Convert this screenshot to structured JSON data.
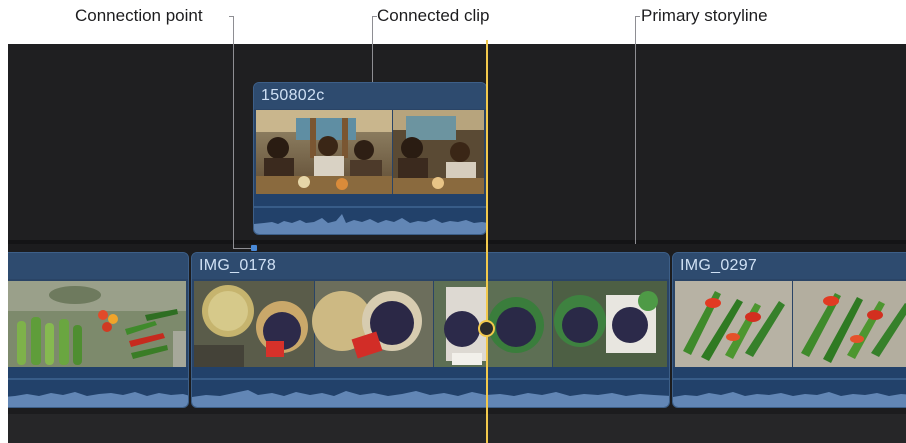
{
  "callouts": {
    "connection_point": "Connection point",
    "connected_clip": "Connected clip",
    "primary_storyline": "Primary storyline"
  },
  "connected_clips": [
    {
      "title": "150802c"
    }
  ],
  "primary_clips": [
    {
      "title": ""
    },
    {
      "title": "IMG_0178"
    },
    {
      "title": "IMG_0297"
    }
  ],
  "colors": {
    "clip_blue": "#2a4466",
    "playhead": "#f2c94c",
    "timeline_bg": "#262628",
    "audio_wave": "#6d93c2"
  }
}
